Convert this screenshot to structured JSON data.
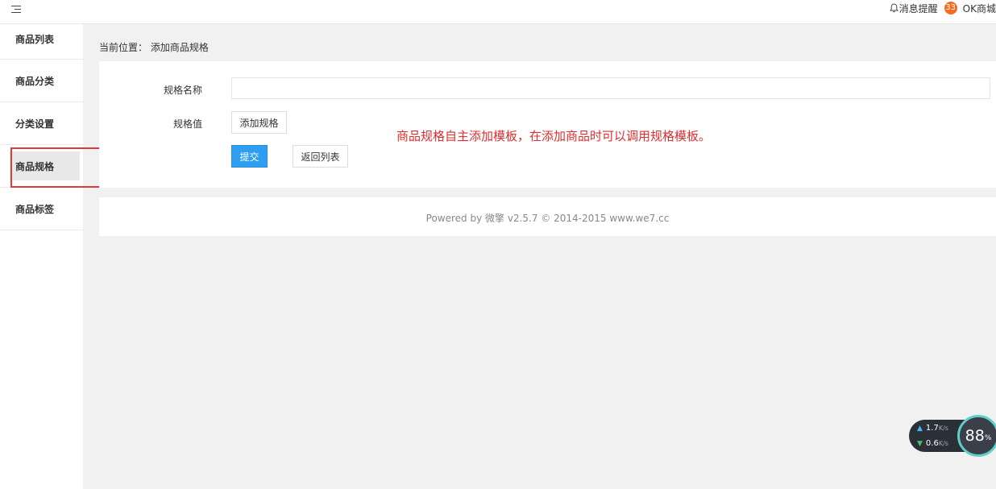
{
  "header": {
    "notice_label": "消息提醒",
    "notice_count": "33",
    "shop_name": "OK商城"
  },
  "sidebar": {
    "items": [
      {
        "label": "商品列表"
      },
      {
        "label": "商品分类"
      },
      {
        "label": "分类设置"
      },
      {
        "label": "商品规格"
      },
      {
        "label": "商品标签"
      }
    ]
  },
  "breadcrumb": "当前位置： 添加商品规格",
  "form": {
    "name_label": "规格名称",
    "name_value": "",
    "value_label": "规格值",
    "add_spec_button": "添加规格",
    "submit_button": "提交",
    "back_button": "返回列表"
  },
  "annotation": "商品规格自主添加模板，在添加商品时可以调用规格模板。",
  "footer": "Powered by 微擎 v2.5.7 © 2014-2015 www.we7.cc",
  "net_widget": {
    "upload": "1.7",
    "download": "0.6",
    "unit": "K/s",
    "usage": "88",
    "usage_unit": "%"
  }
}
